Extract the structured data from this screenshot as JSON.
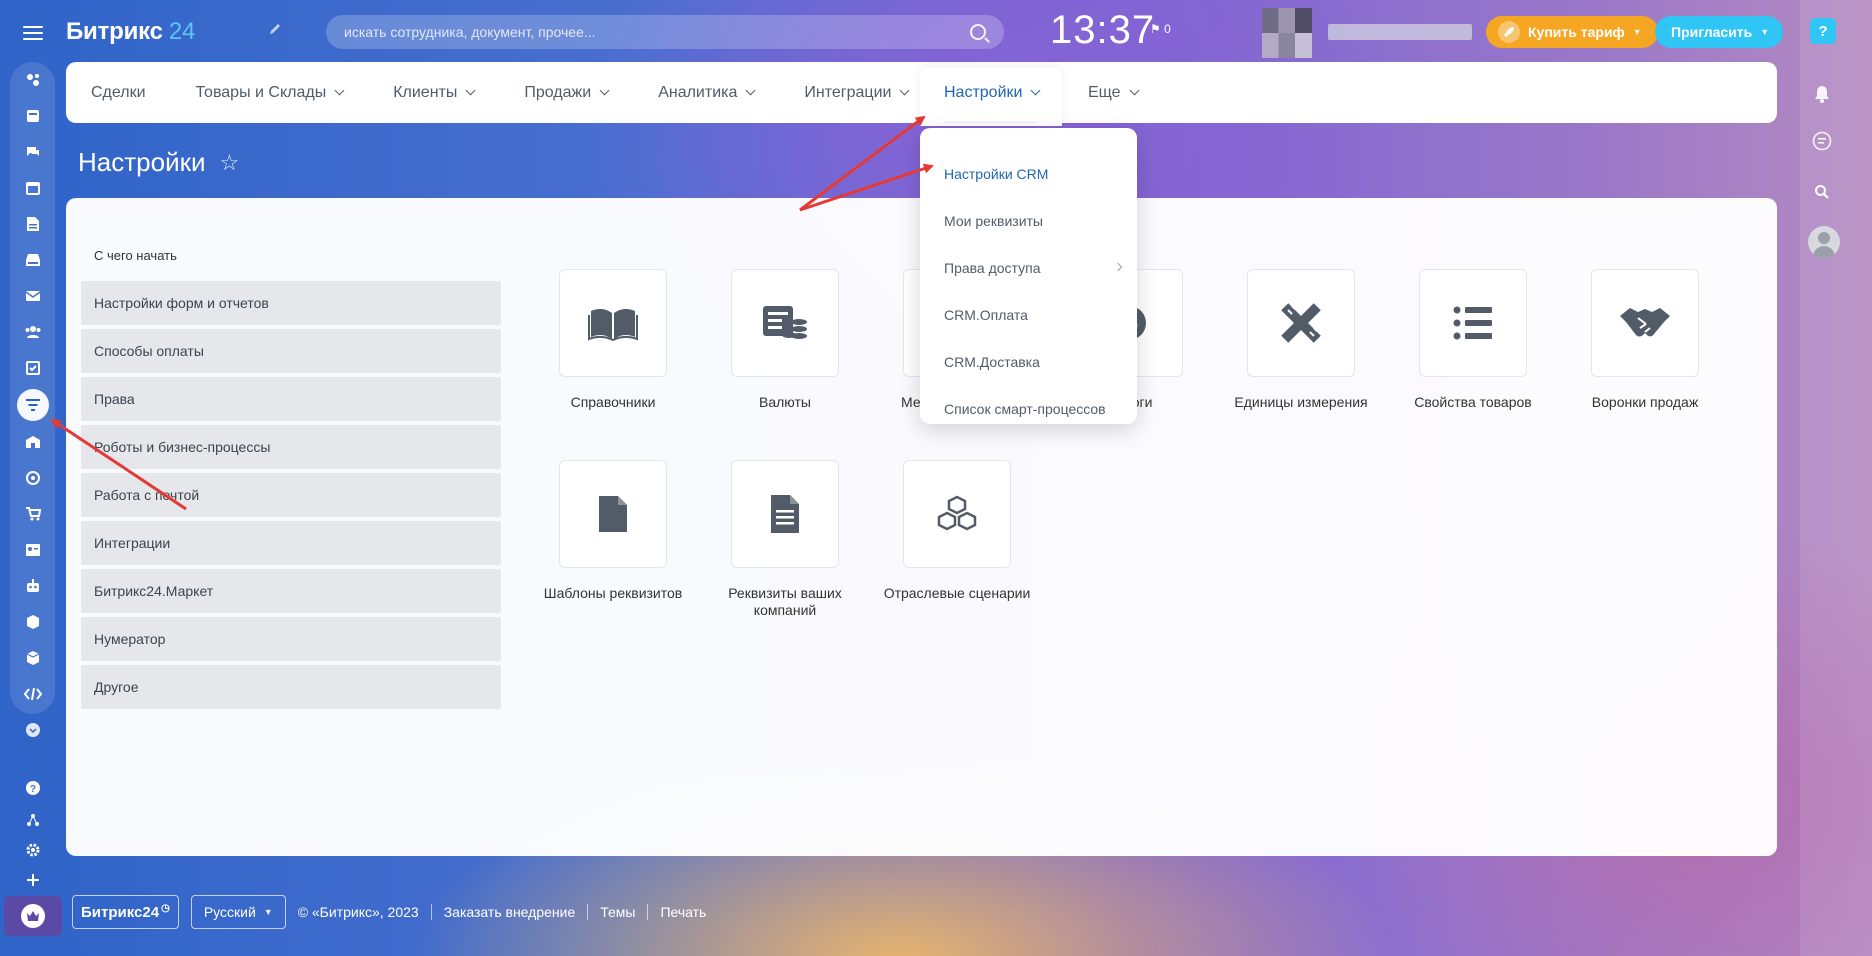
{
  "header": {
    "logo_name": "Битрикс",
    "logo_num": "24",
    "search_placeholder": "искать сотрудника, документ, прочее...",
    "clock": "13:37",
    "flag_count": "0",
    "buy_label": "Купить тариф",
    "invite_label": "Пригласить"
  },
  "nav": {
    "items": [
      {
        "label": "Сделки"
      },
      {
        "label": "Товары и Склады"
      },
      {
        "label": "Клиенты"
      },
      {
        "label": "Продажи"
      },
      {
        "label": "Аналитика"
      },
      {
        "label": "Интеграции"
      },
      {
        "label": "Настройки"
      },
      {
        "label": "Еще"
      }
    ]
  },
  "page": {
    "title": "Настройки"
  },
  "side": {
    "heading": "С чего начать",
    "items": [
      "Настройки форм и отчетов",
      "Способы оплаты",
      "Права",
      "Роботы и бизнес-процессы",
      "Работа с почтой",
      "Интеграции",
      "Битрикс24.Маркет",
      "Нумератор",
      "Другое"
    ]
  },
  "tiles": [
    {
      "label": "Справочники",
      "icon": "book-icon"
    },
    {
      "label": "Валюты",
      "icon": "currency-icon"
    },
    {
      "label": "Местоположения",
      "icon": "location-icon"
    },
    {
      "label": "Налоги",
      "icon": "tax-icon"
    },
    {
      "label": "Единицы измерения",
      "icon": "ruler-icon"
    },
    {
      "label": "Свойства товаров",
      "icon": "list-icon"
    },
    {
      "label": "Воронки продаж",
      "icon": "handshake-icon"
    },
    {
      "label": "Шаблоны реквизитов",
      "icon": "document-icon"
    },
    {
      "label": "Реквизиты ваших компаний",
      "icon": "document-lines-icon"
    },
    {
      "label": "Отраслевые сценарии",
      "icon": "boxes-icon"
    }
  ],
  "dropdown": {
    "items": [
      {
        "label": "Настройки CRM"
      },
      {
        "label": "Мои реквизиты"
      },
      {
        "label": "Права доступа"
      },
      {
        "label": "CRM.Оплата"
      },
      {
        "label": "CRM.Доставка"
      },
      {
        "label": "Список смарт-процессов"
      }
    ]
  },
  "footer": {
    "logo": "Битрикс24",
    "lang": "Русский",
    "copyright": "© «Битрикс», 2023",
    "order": "Заказать внедрение",
    "themes": "Темы",
    "print": "Печать"
  },
  "colors": {
    "accent_blue": "#2067b0",
    "buy_orange": "#f5a623",
    "invite_cyan": "#2fc6f6",
    "annotation_red": "#e53935"
  }
}
